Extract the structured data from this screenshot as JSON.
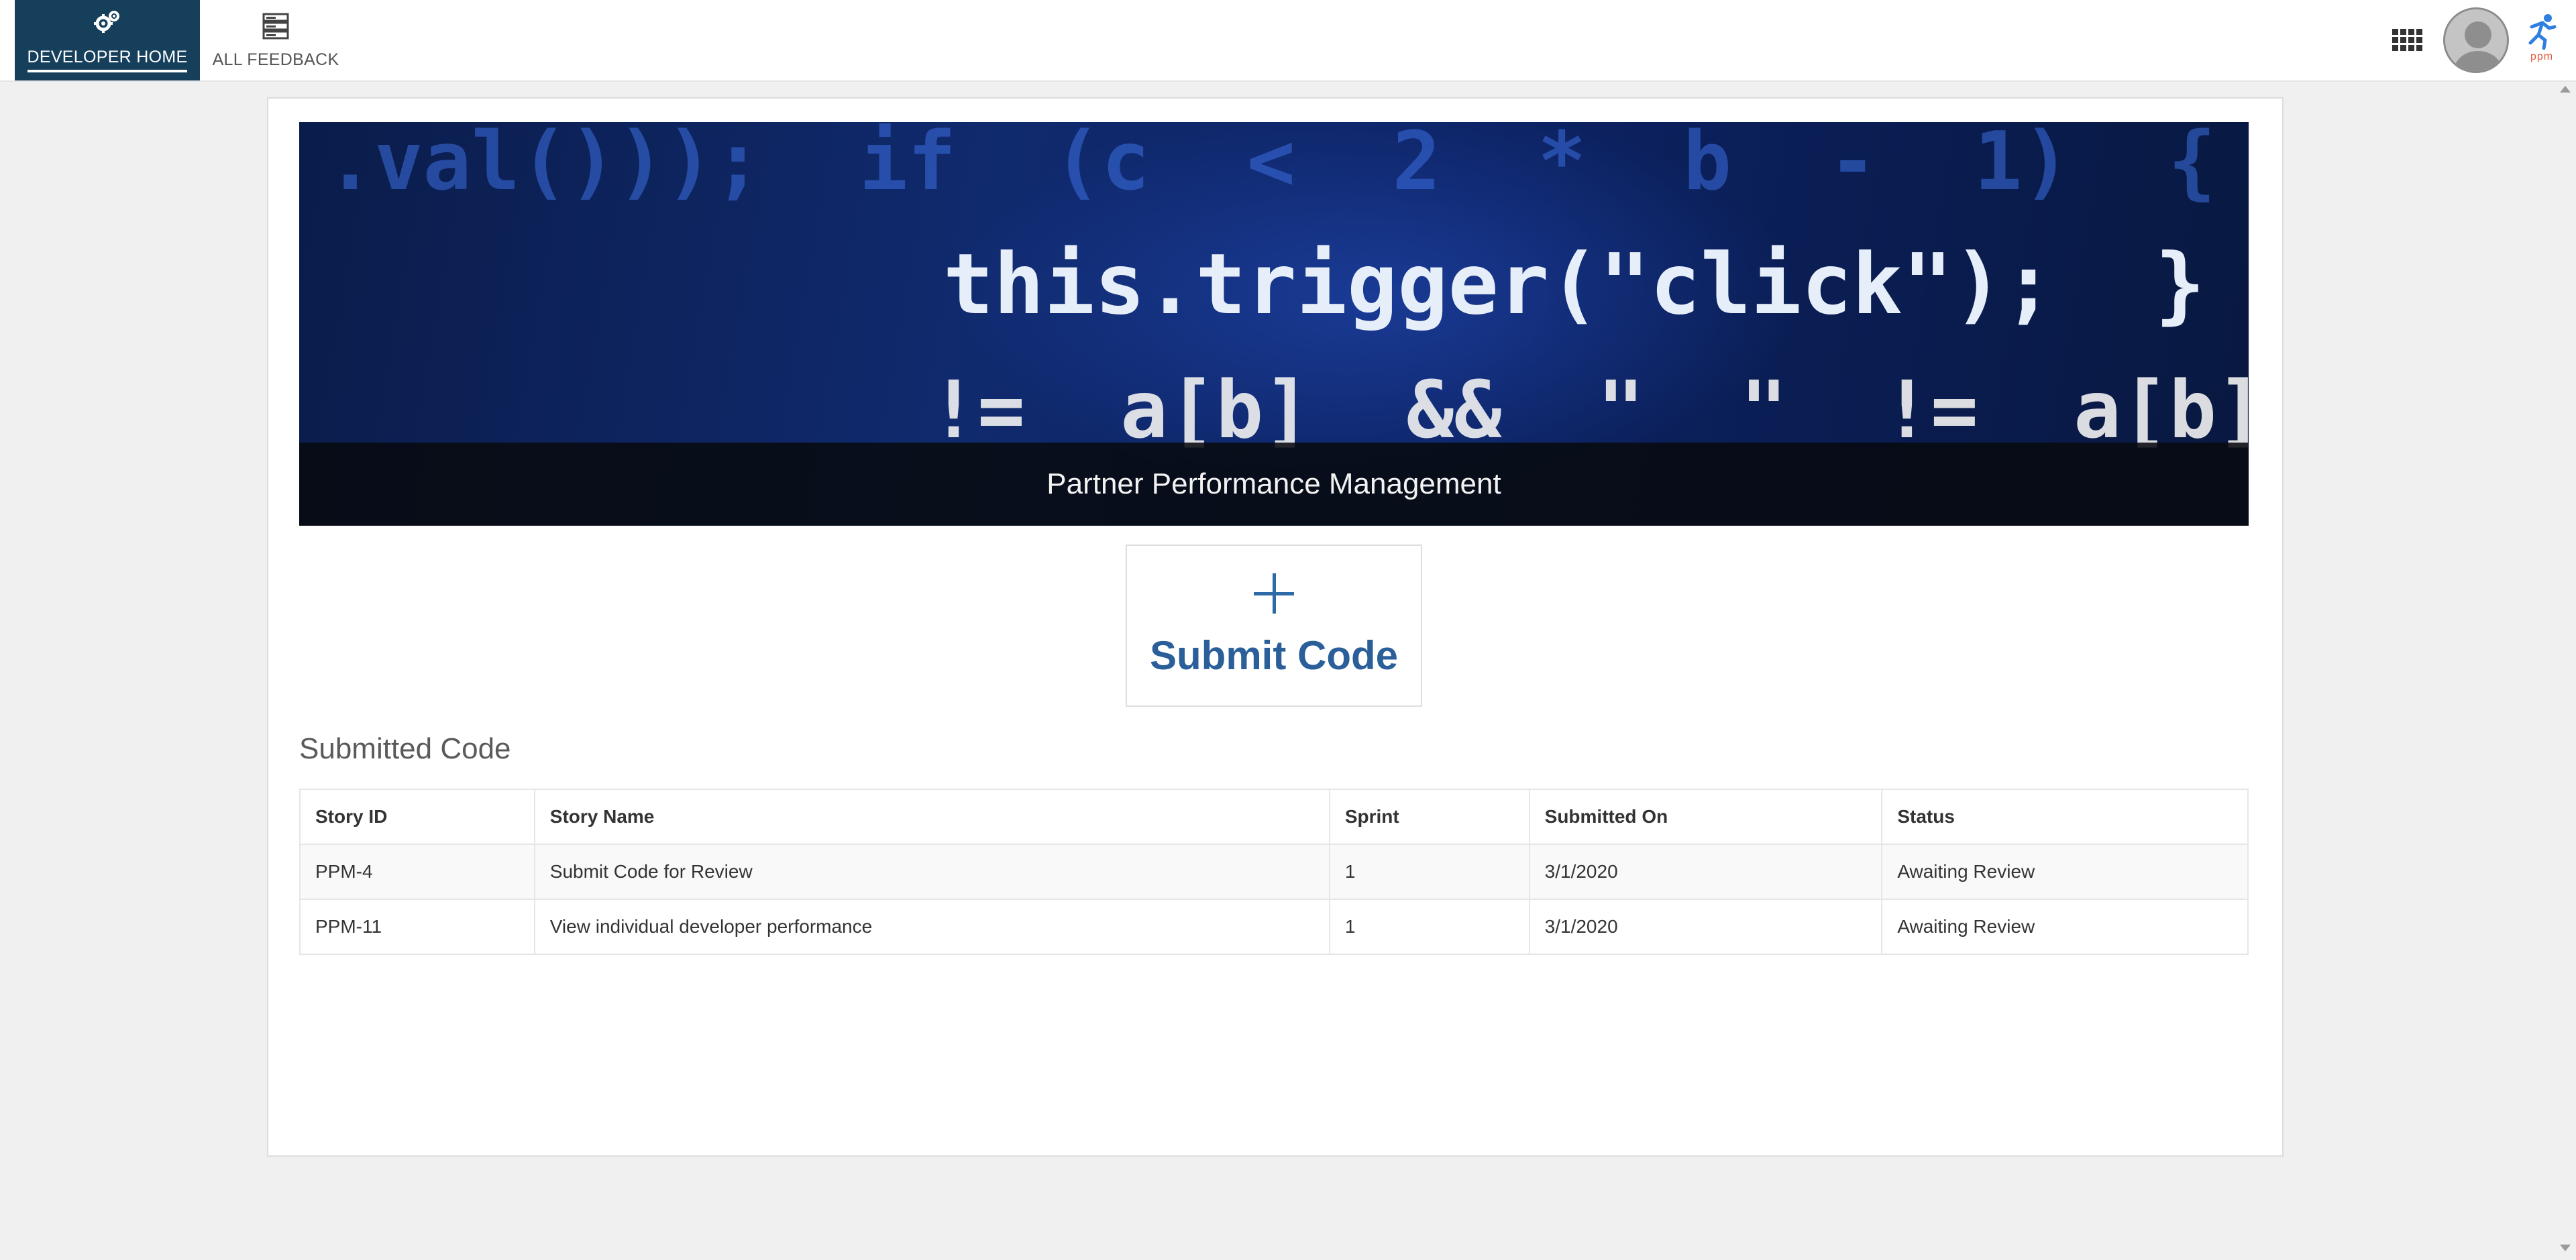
{
  "nav": {
    "tabs": [
      {
        "label": "DEVELOPER HOME",
        "icon": "gears-icon",
        "active": true
      },
      {
        "label": "ALL FEEDBACK",
        "icon": "server-list-icon",
        "active": false
      }
    ],
    "apps_icon": "grid-apps-icon",
    "avatar_icon": "user-avatar-icon",
    "brand": {
      "icon": "runner-logo-icon",
      "text": "ppm"
    }
  },
  "hero": {
    "caption": "Partner Performance Management",
    "code_lines": [
      ".val()));  if  (c  <  2  *  b  -  1)  {",
      "this.trigger(\"click\");  }",
      "!=  a[b]  &&  \"  \"  !=  a[b]"
    ]
  },
  "submit_tile": {
    "icon": "plus-icon",
    "label": "Submit Code"
  },
  "submitted": {
    "title": "Submitted Code",
    "columns": [
      "Story ID",
      "Story Name",
      "Sprint",
      "Submitted On",
      "Status"
    ],
    "rows": [
      [
        "PPM-4",
        "Submit Code for Review",
        "1",
        "3/1/2020",
        "Awaiting Review"
      ],
      [
        "PPM-11",
        "View individual developer performance",
        "1",
        "3/1/2020",
        "Awaiting Review"
      ]
    ]
  },
  "colors": {
    "active_tab_bg": "#163f5c",
    "accent_blue": "#2a5f99",
    "page_bg": "#f0f0f0"
  }
}
